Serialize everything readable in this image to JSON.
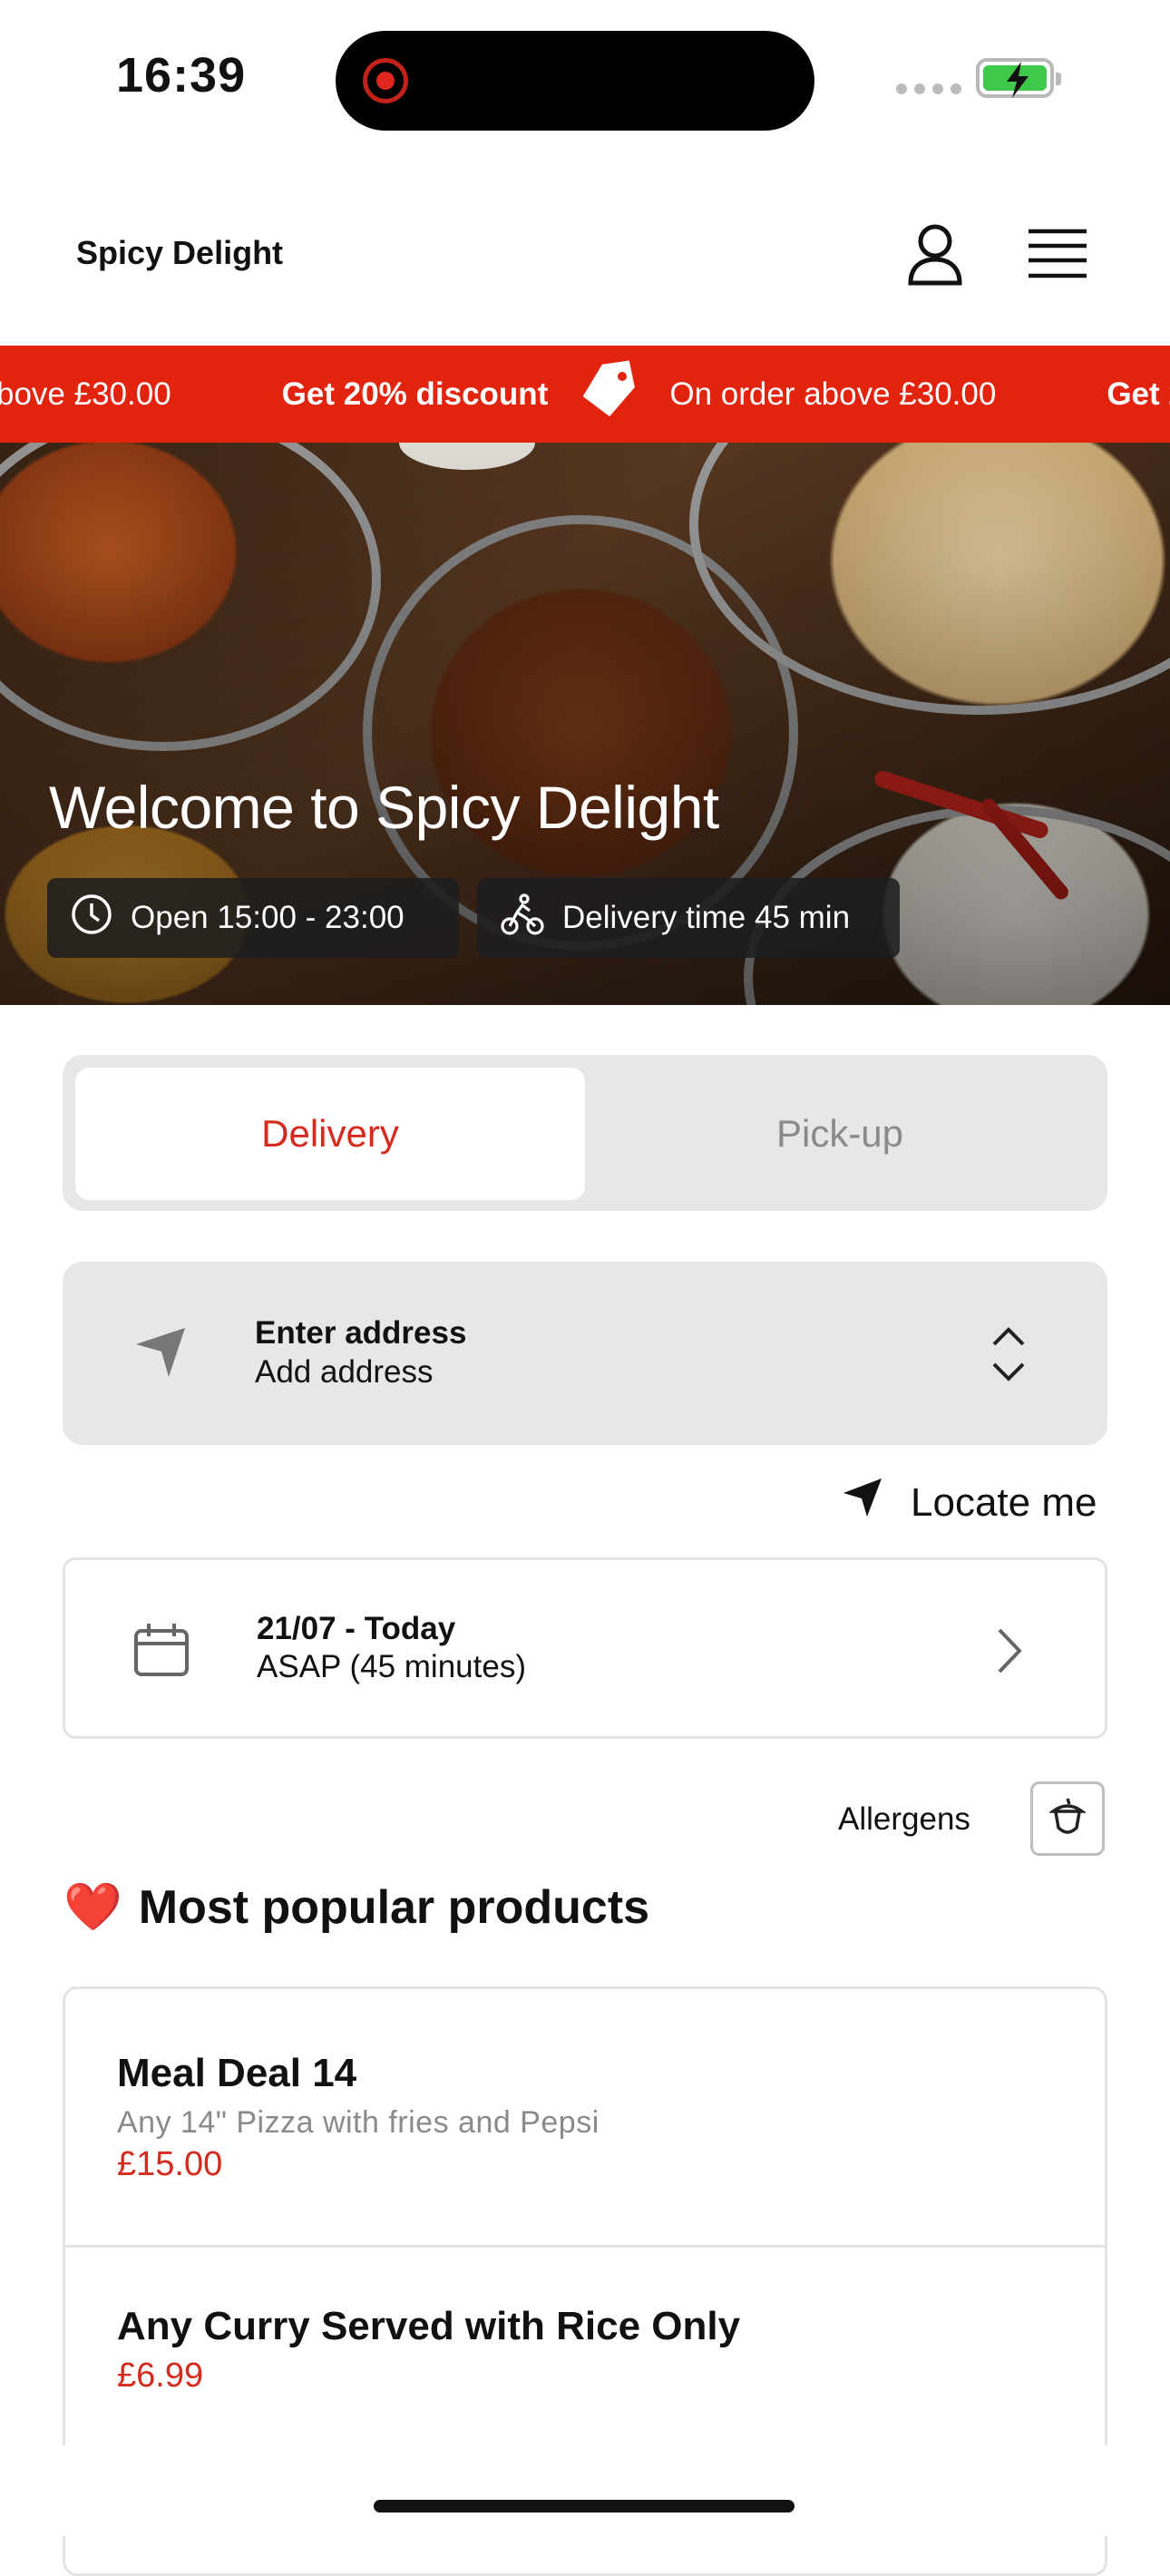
{
  "status_bar": {
    "time": "16:39",
    "battery_charging": true
  },
  "header": {
    "brand": "Spicy Delight",
    "icons": [
      "user-icon",
      "hamburger-menu-icon"
    ]
  },
  "promo": {
    "segments": [
      {
        "strong": "Get 20% discount",
        "text": "On order above £30.00"
      }
    ],
    "left_fragment": "bove £30.00",
    "icon": "tag-icon",
    "color": "#e2240e"
  },
  "hero": {
    "title": "Welcome to Spicy Delight",
    "open_hours": "Open 15:00 - 23:00",
    "delivery_time": "Delivery time 45 min",
    "icons": [
      "clock-icon",
      "cyclist-icon"
    ]
  },
  "order_type": {
    "options": [
      "Delivery",
      "Pick-up"
    ],
    "selected": "Delivery"
  },
  "address": {
    "title": "Enter address",
    "subtitle": "Add address",
    "icon": "navigation-arrow-icon"
  },
  "locate": {
    "label": "Locate me"
  },
  "schedule": {
    "date": "21/07 - Today",
    "time": "ASAP (45 minutes)",
    "icon": "calendar-icon"
  },
  "allergens": {
    "label": "Allergens",
    "icon": "acorn-icon"
  },
  "popular": {
    "emoji": "❤️",
    "title": "Most popular products",
    "products": [
      {
        "name": "Meal Deal 14",
        "description": "Any 14\" Pizza with fries and Pepsi",
        "price": "£15.00"
      },
      {
        "name": "Any Curry Served with Rice Only",
        "description": "",
        "price": "£6.99"
      }
    ]
  },
  "colors": {
    "accent": "#d52b1e",
    "promo_bg": "#e2240e",
    "panel_bg": "#e7e7e7"
  }
}
